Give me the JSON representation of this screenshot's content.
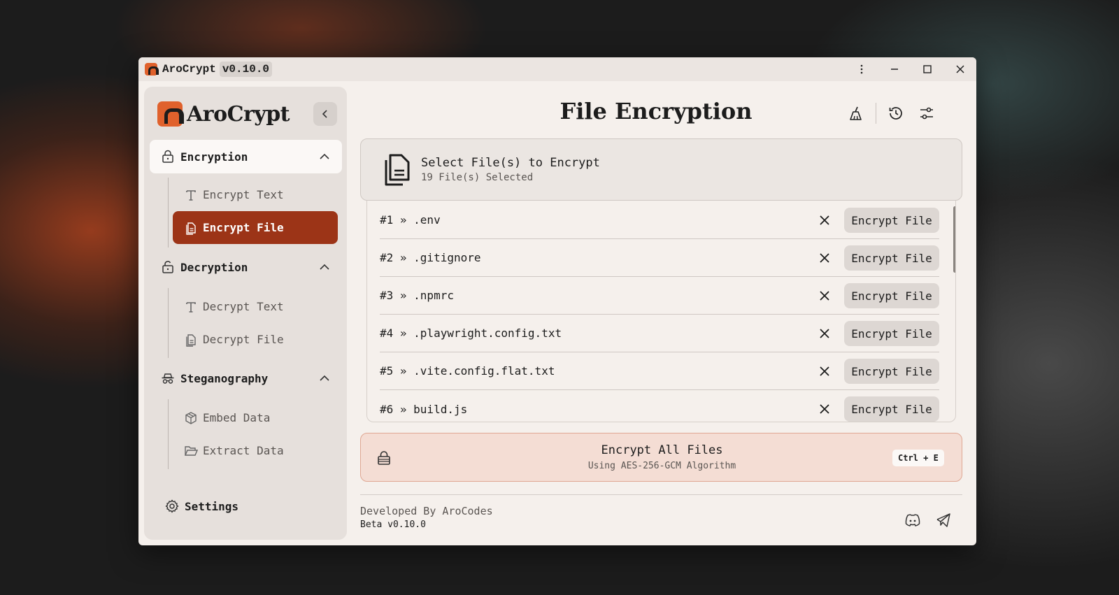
{
  "titlebar": {
    "app_name": "AroCrypt",
    "version": "v0.10.0"
  },
  "sidebar": {
    "app_name": "AroCrypt",
    "sections": [
      {
        "label": "Encryption",
        "icon": "lock-icon",
        "expanded": true,
        "items": [
          {
            "label": "Encrypt Text",
            "icon": "text-icon"
          },
          {
            "label": "Encrypt File",
            "icon": "file-icon",
            "active": true
          }
        ]
      },
      {
        "label": "Decryption",
        "icon": "unlock-icon",
        "expanded": true,
        "items": [
          {
            "label": "Decrypt Text",
            "icon": "text-icon"
          },
          {
            "label": "Decrypt File",
            "icon": "file-icon"
          }
        ]
      },
      {
        "label": "Steganography",
        "icon": "spy-icon",
        "expanded": true,
        "items": [
          {
            "label": "Embed Data",
            "icon": "package-icon"
          },
          {
            "label": "Extract Data",
            "icon": "folder-open-icon"
          }
        ]
      }
    ],
    "settings_label": "Settings"
  },
  "main": {
    "title": "File Encryption",
    "select": {
      "title": "Select File(s) to Encrypt",
      "subtitle": "19 File(s) Selected"
    },
    "files": [
      {
        "label": "#1 » .env",
        "button": "Encrypt File"
      },
      {
        "label": "#2 » .gitignore",
        "button": "Encrypt File"
      },
      {
        "label": "#3 » .npmrc",
        "button": "Encrypt File"
      },
      {
        "label": "#4 » .playwright.config.txt",
        "button": "Encrypt File"
      },
      {
        "label": "#5 » .vite.config.flat.txt",
        "button": "Encrypt File"
      },
      {
        "label": "#6 » build.js",
        "button": "Encrypt File"
      }
    ],
    "encrypt_all": {
      "title": "Encrypt All Files",
      "subtitle": "Using AES-256-GCM Algorithm",
      "shortcut": "Ctrl + E"
    }
  },
  "footer": {
    "developer": "Developed By AroCodes",
    "version": "Beta v0.10.0"
  },
  "colors": {
    "accent": "#e0612c",
    "active_item": "#9c3417",
    "window_bg": "#f5f0ec",
    "sidebar_bg": "#e6e0dc"
  }
}
